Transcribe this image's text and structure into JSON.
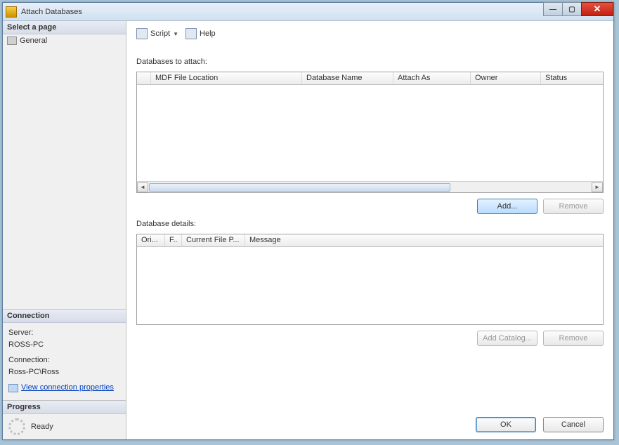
{
  "title": "Attach Databases",
  "sidebar": {
    "select_page": "Select a page",
    "general": "General",
    "connection_header": "Connection",
    "server_label": "Server:",
    "server_value": "ROSS-PC",
    "connection_label": "Connection:",
    "connection_value": "Ross-PC\\Ross",
    "view_conn_props": "View connection properties",
    "progress_header": "Progress",
    "progress_status": "Ready"
  },
  "toolbar": {
    "script": "Script",
    "help": "Help"
  },
  "attach": {
    "label": "Databases to attach:",
    "columns": {
      "c0": "",
      "c1": "MDF File Location",
      "c2": "Database Name",
      "c3": "Attach As",
      "c4": "Owner",
      "c5": "Status"
    },
    "add": "Add...",
    "remove": "Remove"
  },
  "details": {
    "label": "Database details:",
    "columns": {
      "c0": "Ori...",
      "c1": "F..",
      "c2": "Current File P...",
      "c3": "Message"
    },
    "add_catalog": "Add Catalog...",
    "remove": "Remove"
  },
  "footer": {
    "ok": "OK",
    "cancel": "Cancel"
  }
}
